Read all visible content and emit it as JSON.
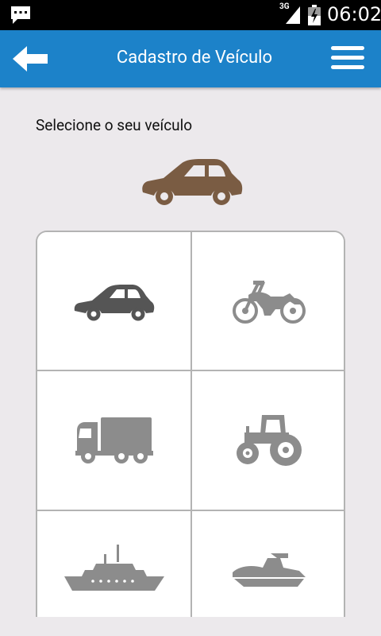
{
  "status_bar": {
    "network_type": "3G",
    "time": "06:02",
    "icons": [
      "message-icon",
      "signal-icon",
      "battery-charging-icon"
    ]
  },
  "app_bar": {
    "title": "Cadastro de Veículo",
    "back_icon": "arrow-left-icon",
    "menu_icon": "hamburger-menu-icon"
  },
  "main": {
    "prompt": "Selecione o seu veículo",
    "selected_vehicle": "car-icon",
    "vehicle_options": [
      {
        "icon": "car-icon",
        "selected": true
      },
      {
        "icon": "motorcycle-icon",
        "selected": false
      },
      {
        "icon": "truck-icon",
        "selected": false
      },
      {
        "icon": "tractor-icon",
        "selected": false
      },
      {
        "icon": "ship-icon",
        "selected": false
      },
      {
        "icon": "jet-ski-icon",
        "selected": false
      }
    ]
  },
  "colors": {
    "app_bar": "#1c82c9",
    "selected_vehicle": "#7a5c43",
    "icon_selected": "#555555",
    "icon_unselected": "#8c8c8c",
    "background": "#ece9ec"
  }
}
